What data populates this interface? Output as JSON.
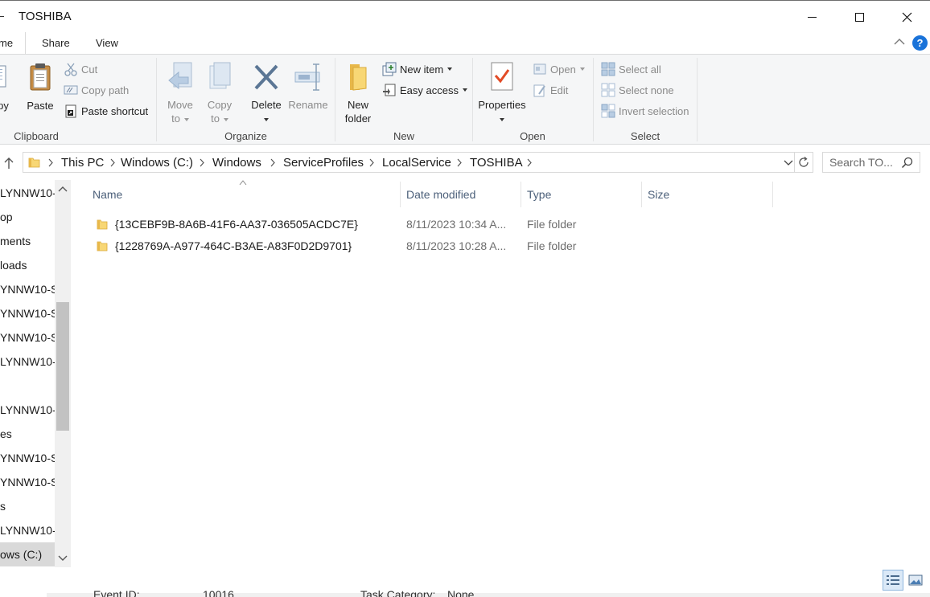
{
  "window": {
    "title": "TOSHIBA"
  },
  "ribbon_tabs": {
    "home": "me",
    "share": "Share",
    "view": "View"
  },
  "ribbon": {
    "clipboard": {
      "copy": "py",
      "paste": "Paste",
      "cut": "Cut",
      "copy_path": "Copy path",
      "paste_shortcut": "Paste shortcut",
      "label": "Clipboard"
    },
    "organize": {
      "move_to_1": "Move",
      "move_to_2": "to",
      "copy_to_1": "Copy",
      "copy_to_2": "to",
      "delete": "Delete",
      "rename": "Rename",
      "label": "Organize"
    },
    "new": {
      "new_folder_1": "New",
      "new_folder_2": "folder",
      "new_item": "New item",
      "easy_access": "Easy access",
      "label": "New"
    },
    "open": {
      "properties": "Properties",
      "open": "Open",
      "edit": "Edit",
      "label": "Open"
    },
    "select": {
      "select_all": "Select all",
      "select_none": "Select none",
      "invert_selection": "Invert selection",
      "label": "Select"
    }
  },
  "address": {
    "crumbs": [
      "This PC",
      "Windows (C:)",
      "Windows",
      "ServiceProfiles",
      "LocalService",
      "TOSHIBA"
    ],
    "search_placeholder": "Search TO..."
  },
  "nav": {
    "items": [
      "LYNNW10-",
      "op",
      "ments",
      "loads",
      "YNNW10-S",
      "YNNW10-S",
      "YNNW10-S",
      "LYNNW10-",
      "",
      "LYNNW10-",
      "es",
      "YNNW10-S",
      "YNNW10-S",
      "s",
      "LYNNW10-",
      "ows (C:)"
    ]
  },
  "list": {
    "columns": {
      "name": "Name",
      "date": "Date modified",
      "type": "Type",
      "size": "Size"
    },
    "rows": [
      {
        "name": "{13CEBF9B-8A6B-41F6-AA37-036505ACDC7E}",
        "date": "8/11/2023 10:34 A...",
        "type": "File folder",
        "size": ""
      },
      {
        "name": "{1228769A-A977-464C-B3AE-A83F0D2D9701}",
        "date": "8/11/2023 10:28 A...",
        "type": "File folder",
        "size": ""
      }
    ]
  },
  "background_window": {
    "text1": "Event ID:",
    "text2": "10016",
    "text3": "Task Category:",
    "text4": "None"
  },
  "colors": {
    "folder_yellow": "#f8d775",
    "accent_blue": "#1a73d9",
    "header_text": "#4c607a"
  }
}
